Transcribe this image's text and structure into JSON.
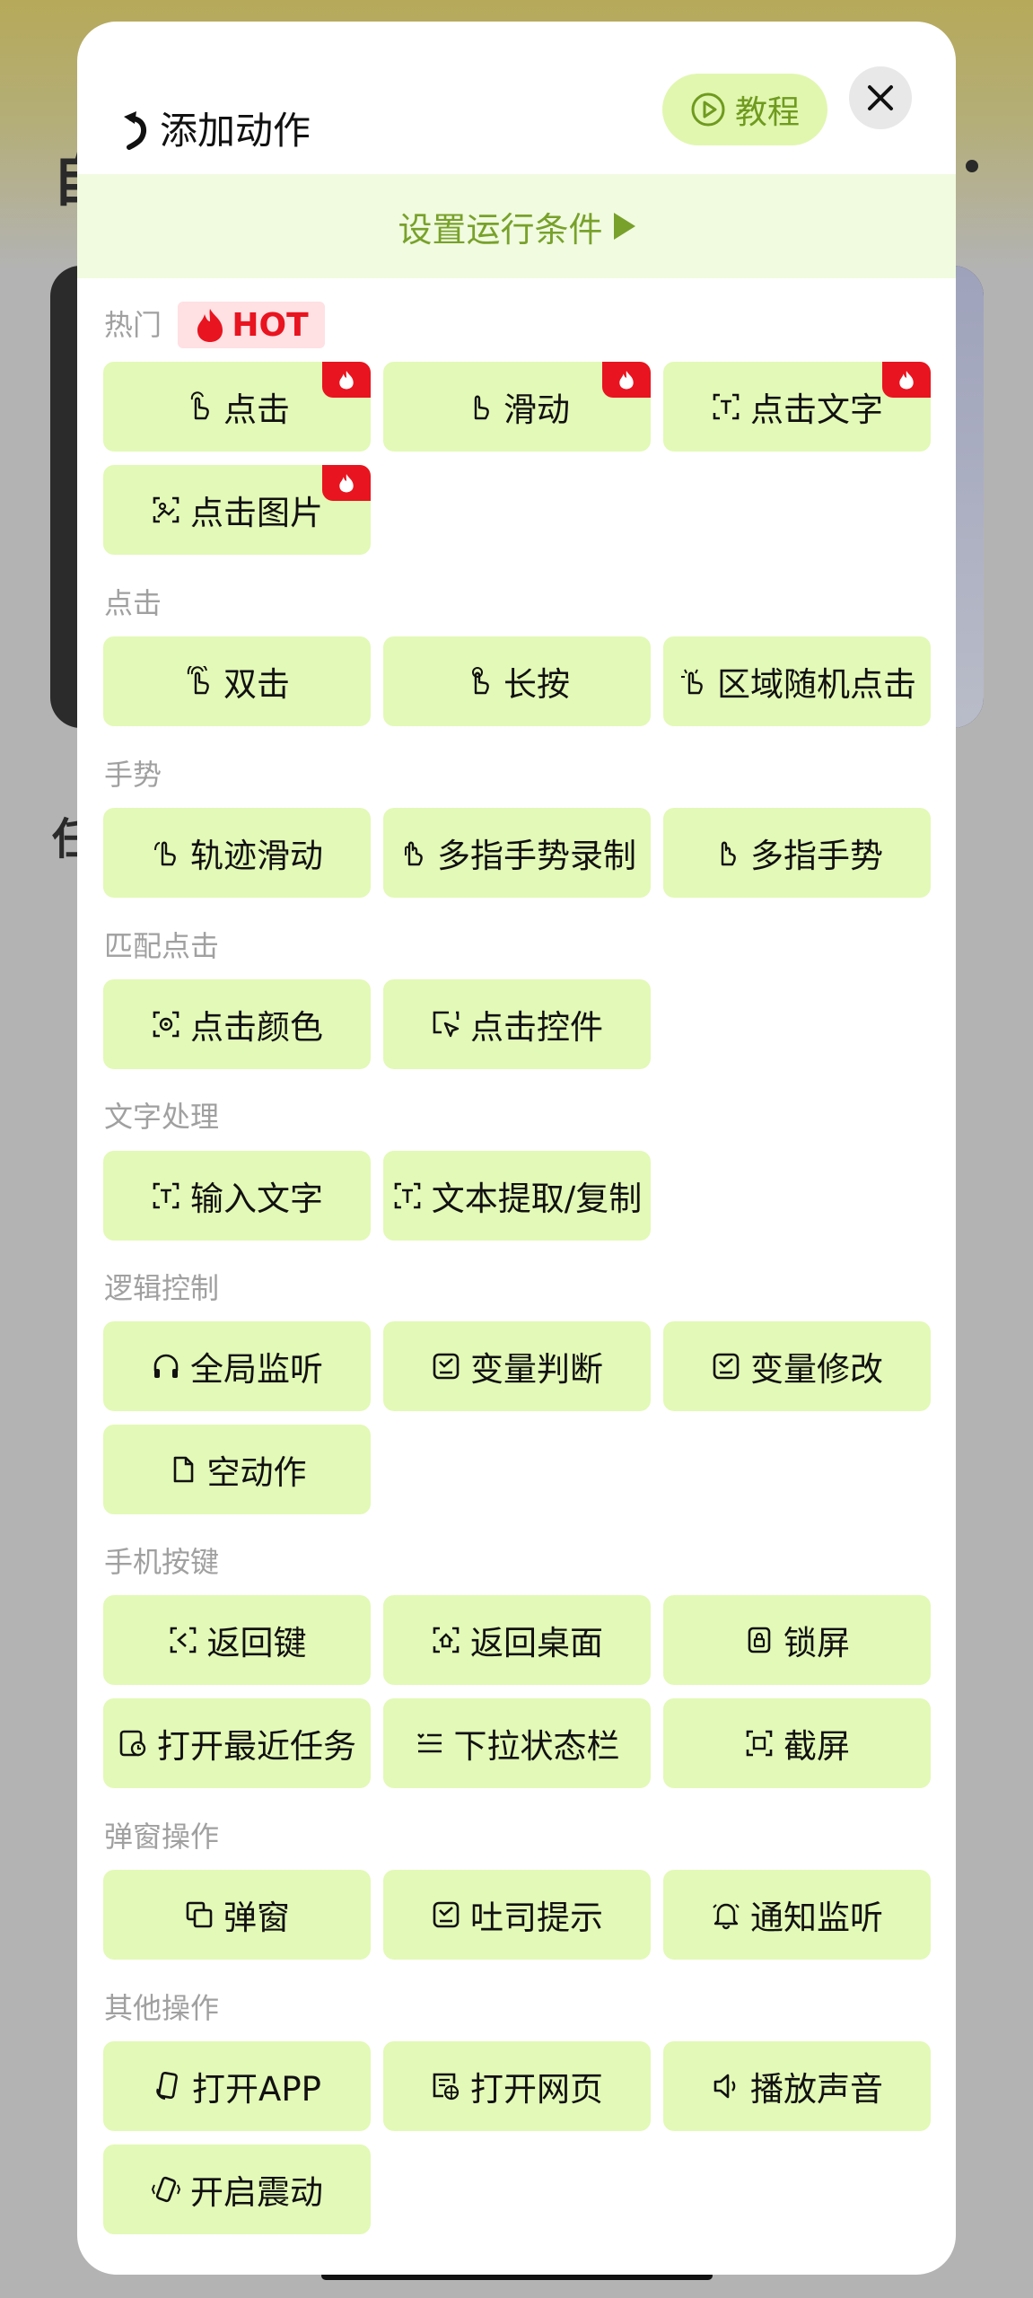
{
  "header": {
    "title": "添加动作",
    "tutorial_label": "教程"
  },
  "condition_bar": {
    "label": "设置运行条件"
  },
  "hot_badge": {
    "label": "HOT"
  },
  "background": {
    "char_a": "自",
    "char_b": "任"
  },
  "colors": {
    "accent_green": "#78a12b",
    "button_bg": "#e3f9b7",
    "hot_red": "#e8141f"
  },
  "sections": {
    "hot": {
      "title": "热门",
      "buttons": [
        "点击",
        "滑动",
        "点击文字",
        "点击图片"
      ]
    },
    "tap": {
      "title": "点击",
      "buttons": [
        "双击",
        "长按",
        "区域随机点击"
      ]
    },
    "gesture": {
      "title": "手势",
      "buttons": [
        "轨迹滑动",
        "多指手势录制",
        "多指手势"
      ]
    },
    "match": {
      "title": "匹配点击",
      "buttons": [
        "点击颜色",
        "点击控件"
      ]
    },
    "text": {
      "title": "文字处理",
      "buttons": [
        "输入文字",
        "文本提取/复制"
      ]
    },
    "logic": {
      "title": "逻辑控制",
      "buttons": [
        "全局监听",
        "变量判断",
        "变量修改",
        "空动作"
      ]
    },
    "keys": {
      "title": "手机按键",
      "buttons": [
        "返回键",
        "返回桌面",
        "锁屏",
        "打开最近任务",
        "下拉状态栏",
        "截屏"
      ]
    },
    "popup": {
      "title": "弹窗操作",
      "buttons": [
        "弹窗",
        "吐司提示",
        "通知监听"
      ]
    },
    "other": {
      "title": "其他操作",
      "buttons": [
        "打开APP",
        "打开网页",
        "播放声音",
        "开启震动"
      ]
    }
  }
}
